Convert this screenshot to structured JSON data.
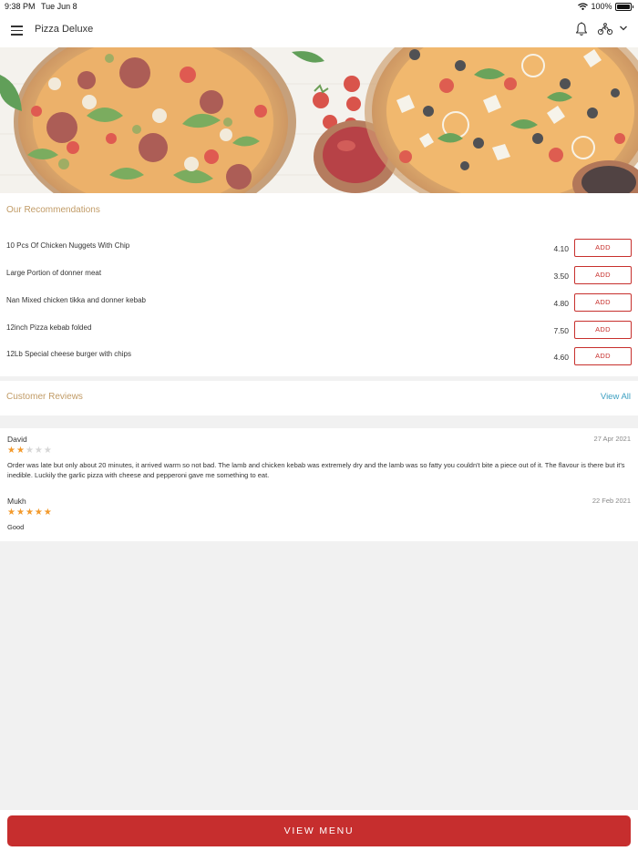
{
  "status_bar": {
    "time": "9:38 PM",
    "date": "Tue Jun 8",
    "battery": "100%"
  },
  "app_bar": {
    "title": "Pizza Deluxe"
  },
  "recommendations": {
    "title": "Our Recommendations",
    "items": [
      {
        "name": "10 Pcs Of Chicken Nuggets With Chip",
        "price": "4.10",
        "action": "ADD"
      },
      {
        "name": "Large Portion of donner meat",
        "price": "3.50",
        "action": "ADD"
      },
      {
        "name": "Nan Mixed chicken tikka and donner kebab",
        "price": "4.80",
        "action": "ADD"
      },
      {
        "name": "12inch Pizza kebab folded",
        "price": "7.50",
        "action": "ADD"
      },
      {
        "name": "12Lb Special cheese burger with chips",
        "price": "4.60",
        "action": "ADD"
      }
    ]
  },
  "reviews": {
    "title": "Customer Reviews",
    "view_all": "View All",
    "items": [
      {
        "name": "David",
        "date": "27 Apr 2021",
        "rating": 2,
        "max_rating": 5,
        "text": "Order was late but only about 20 minutes, it arrived warm so not bad. The lamb and chicken kebab was extremely dry and the lamb was so fatty you couldn't bite a piece out of it. The flavour is there but it's inedible. Luckily the garlic pizza with cheese and pepperoni gave me something to eat."
      },
      {
        "name": "Mukh",
        "date": "22 Feb 2021",
        "rating": 5,
        "max_rating": 5,
        "text": "Good"
      }
    ]
  },
  "footer": {
    "view_menu_label": "VIEW MENU"
  },
  "colors": {
    "accent_red": "#c62e2e",
    "section_title_gold": "#c19b66",
    "link_blue": "#3c9fc1",
    "star_filled": "#f39a2c",
    "star_empty": "#d6d6d6"
  },
  "icons": [
    "menu-icon",
    "bell-icon",
    "delivery-icon",
    "chevron-down-icon",
    "wifi-icon",
    "battery-icon",
    "star-icon"
  ]
}
